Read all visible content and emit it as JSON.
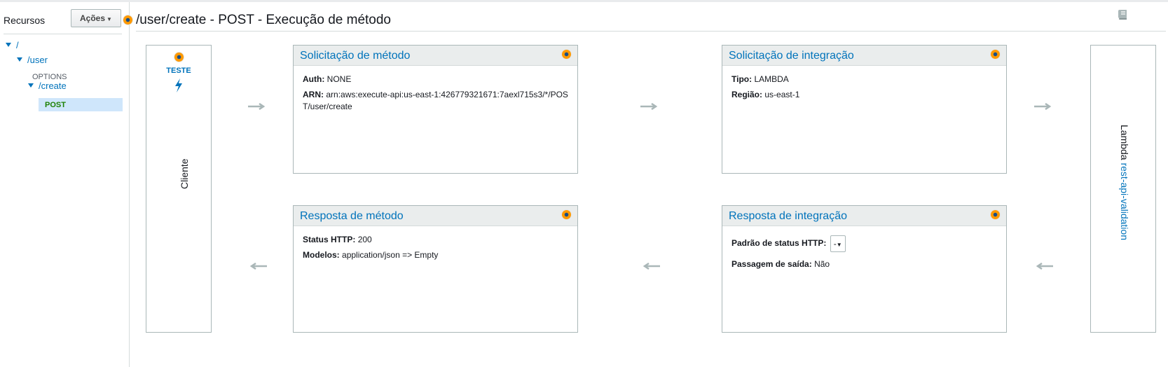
{
  "sidebar": {
    "title": "Recursos",
    "actions_label": "Ações",
    "tree": {
      "root": "/",
      "user": "/user",
      "options": "OPTIONS",
      "create": "/create",
      "post": "POST"
    }
  },
  "header": {
    "title": "/user/create - POST - Execução de método"
  },
  "client": {
    "test_label": "TESTE",
    "label": "Cliente"
  },
  "method_request": {
    "title": "Solicitação de método",
    "auth_label": "Auth:",
    "auth_value": "NONE",
    "arn_label": "ARN:",
    "arn_value": "arn:aws:execute-api:us-east-1:426779321671:7aexl715s3/*/POST/user/create"
  },
  "integration_request": {
    "title": "Solicitação de integração",
    "type_label": "Tipo:",
    "type_value": "LAMBDA",
    "region_label": "Região:",
    "region_value": "us-east-1"
  },
  "method_response": {
    "title": "Resposta de método",
    "status_label": "Status HTTP:",
    "status_value": "200",
    "models_label": "Modelos:",
    "models_value": "application/json => Empty"
  },
  "integration_response": {
    "title": "Resposta de integração",
    "pattern_label": "Padrão de status HTTP:",
    "pattern_value": "-",
    "passthrough_label": "Passagem de saída:",
    "passthrough_value": "Não"
  },
  "lambda": {
    "prefix": "Lambda",
    "function_name": "rest-api-validation"
  },
  "icons": {
    "status_dot": "status-dot-icon",
    "test": "lightning-icon",
    "help": "book-icon",
    "flow": "arrow-icon"
  },
  "colors": {
    "link": "#0073bb",
    "accent": "#ff9900",
    "method_post": "#1d8102",
    "selection": "#cfe6fb"
  }
}
